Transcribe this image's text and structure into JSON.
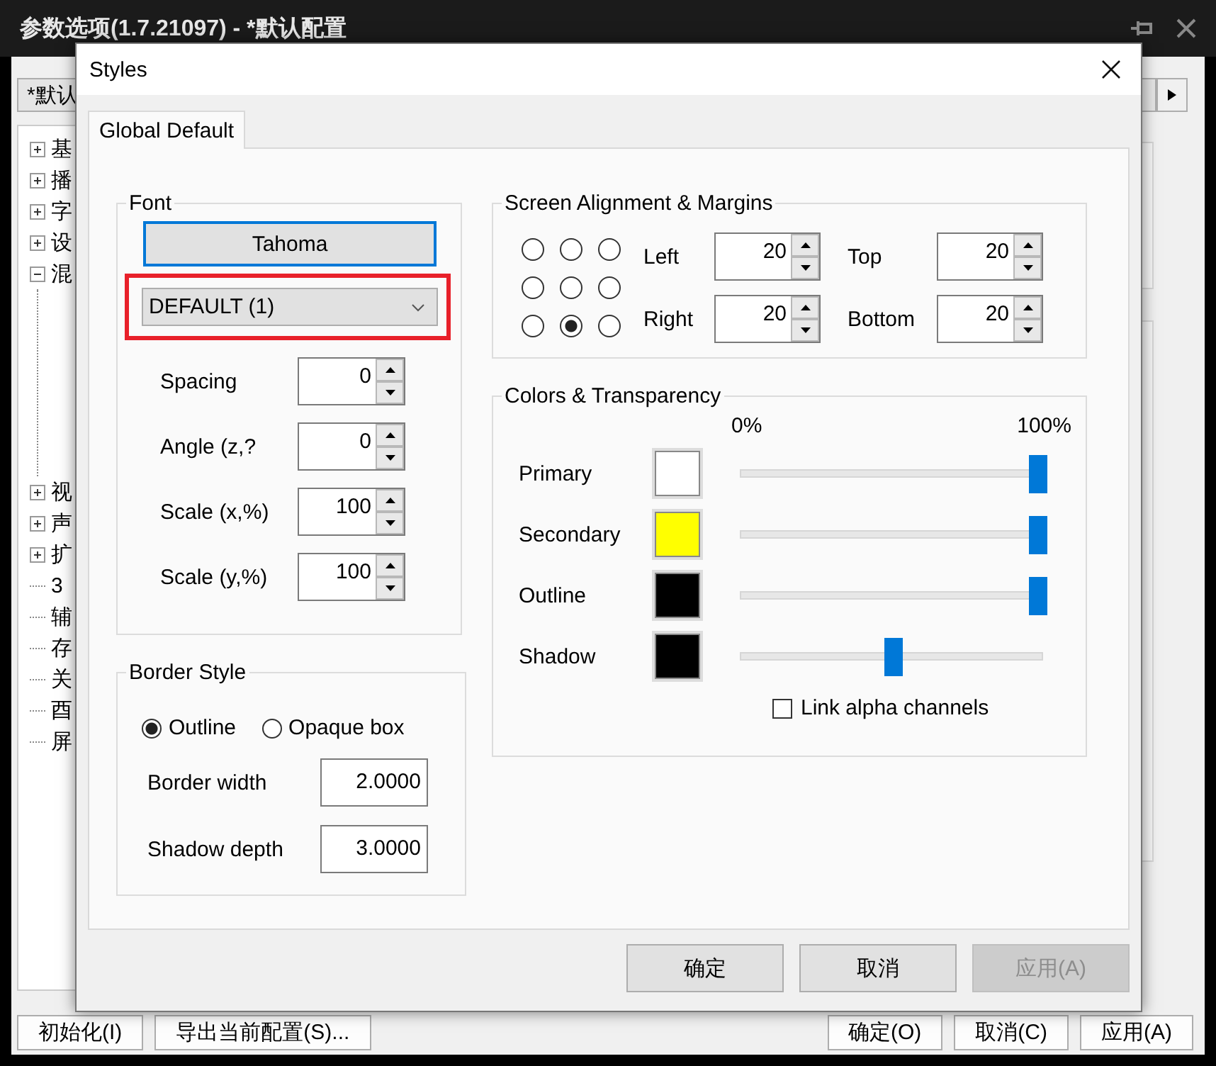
{
  "main_window": {
    "title": "参数选项(1.7.21097) - *默认配置",
    "profile_combo": {
      "value": "*默认"
    },
    "tree": [
      {
        "label": "基",
        "kind": "folder",
        "expanded": false
      },
      {
        "label": "播",
        "kind": "folder",
        "expanded": false
      },
      {
        "label": "字",
        "kind": "folder",
        "expanded": false
      },
      {
        "label": "设",
        "kind": "folder",
        "expanded": false
      },
      {
        "label": "混",
        "kind": "folder",
        "expanded": true
      },
      {
        "label": "视",
        "kind": "folder",
        "expanded": false
      },
      {
        "label": "声",
        "kind": "folder",
        "expanded": false
      },
      {
        "label": "扩",
        "kind": "folder",
        "expanded": false
      },
      {
        "label": "3",
        "kind": "leaf"
      },
      {
        "label": "辅",
        "kind": "leaf"
      },
      {
        "label": "存",
        "kind": "leaf"
      },
      {
        "label": "关",
        "kind": "leaf"
      },
      {
        "label": "酉",
        "kind": "leaf"
      },
      {
        "label": "屏",
        "kind": "leaf"
      }
    ],
    "buttons_left": [
      "初始化(I)",
      "导出当前配置(S)..."
    ],
    "buttons_right": [
      "确定(O)",
      "取消(C)",
      "应用(A)"
    ]
  },
  "dialog": {
    "title": "Styles",
    "tabs": [
      {
        "label": "Global Default",
        "selected": true
      }
    ],
    "font": {
      "title": "Font",
      "font_button": {
        "label": "Tahoma",
        "focused": true
      },
      "style_dropdown": {
        "value": "DEFAULT (1)",
        "highlighted": true
      },
      "fields": [
        {
          "label": "Spacing",
          "value": "0"
        },
        {
          "label": "Angle (z,?",
          "value": "0"
        },
        {
          "label": "Scale (x,%)",
          "value": "100"
        },
        {
          "label": "Scale (y,%)",
          "value": "100"
        }
      ]
    },
    "border_style": {
      "title": "Border Style",
      "options": [
        {
          "label": "Outline",
          "selected": true
        },
        {
          "label": "Opaque box",
          "selected": false
        }
      ],
      "fields": [
        {
          "label": "Border width",
          "value": "2.0000"
        },
        {
          "label": "Shadow depth",
          "value": "3.0000"
        }
      ]
    },
    "alignment": {
      "title": "Screen Alignment & Margins",
      "positions": [
        {
          "selected": false
        },
        {
          "selected": false
        },
        {
          "selected": false
        },
        {
          "selected": false
        },
        {
          "selected": false
        },
        {
          "selected": false
        },
        {
          "selected": false
        },
        {
          "selected": true
        },
        {
          "selected": false
        }
      ],
      "margins": [
        {
          "label": "Left",
          "value": "20"
        },
        {
          "label": "Top",
          "value": "20"
        },
        {
          "label": "Right",
          "value": "20"
        },
        {
          "label": "Bottom",
          "value": "20"
        }
      ]
    },
    "colors": {
      "title": "Colors & Transparency",
      "scale_min": "0%",
      "scale_max": "100%",
      "rows": [
        {
          "label": "Primary",
          "color": "#ffffff",
          "level": 1
        },
        {
          "label": "Secondary",
          "color": "#ffff00",
          "level": 1
        },
        {
          "label": "Outline",
          "color": "#000000",
          "level": 1
        },
        {
          "label": "Shadow",
          "color": "#000000",
          "level": 0.5
        }
      ],
      "link_alpha": {
        "label": "Link alpha channels",
        "checked": false
      }
    },
    "buttons": [
      {
        "label": "确定",
        "disabled": false
      },
      {
        "label": "取消",
        "disabled": false
      },
      {
        "label": "应用(A)",
        "disabled": true
      }
    ]
  }
}
